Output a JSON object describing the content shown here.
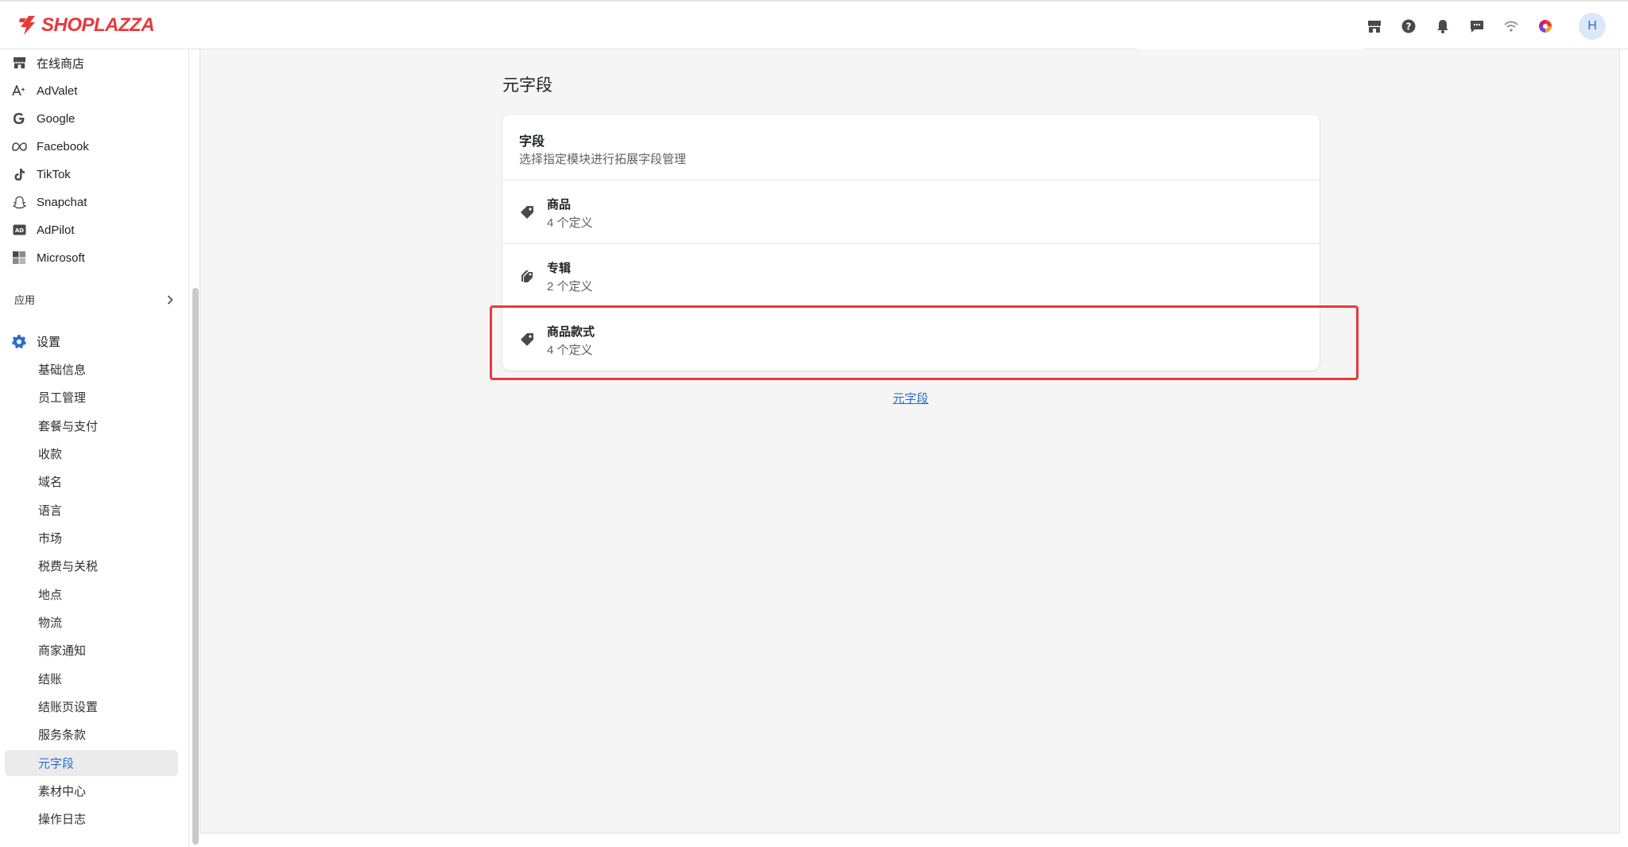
{
  "brand": {
    "name": "SHOPLAZZA",
    "color": "#e8383c"
  },
  "topbar": {
    "icons": [
      "store-icon",
      "help-icon",
      "bell-icon",
      "chat-icon",
      "wifi-icon",
      "color-wheel-icon"
    ],
    "avatar_initial": "H"
  },
  "sidebar": {
    "channels": [
      {
        "label": "在线商店",
        "icon": "store-icon"
      },
      {
        "label": "AdValet",
        "icon": "advalet-icon"
      },
      {
        "label": "Google",
        "icon": "google-icon"
      },
      {
        "label": "Facebook",
        "icon": "meta-icon"
      },
      {
        "label": "TikTok",
        "icon": "tiktok-icon"
      },
      {
        "label": "Snapchat",
        "icon": "snapchat-icon"
      },
      {
        "label": "AdPilot",
        "icon": "adpilot-icon"
      },
      {
        "label": "Microsoft",
        "icon": "microsoft-icon"
      }
    ],
    "apps_label": "应用",
    "settings_label": "设置",
    "settings_items": [
      "基础信息",
      "员工管理",
      "套餐与支付",
      "收款",
      "域名",
      "语言",
      "市场",
      "税费与关税",
      "地点",
      "物流",
      "商家通知",
      "结账",
      "结账页设置",
      "服务条款",
      "元字段",
      "素材中心",
      "操作日志"
    ],
    "active_item": "元字段"
  },
  "main": {
    "title": "元字段",
    "card": {
      "title": "字段",
      "subtitle": "选择指定模块进行拓展字段管理",
      "rows": [
        {
          "title": "商品",
          "count": "4 个定义",
          "icon": "tag-icon"
        },
        {
          "title": "专辑",
          "count": "2 个定义",
          "icon": "collection-tag-icon"
        },
        {
          "title": "商品款式",
          "count": "4 个定义",
          "icon": "tag-icon"
        }
      ]
    },
    "footer_link": "元字段"
  },
  "colors": {
    "accent": "#2c6ecb",
    "highlight": "#e8383c",
    "background": "#f5f5f5"
  }
}
